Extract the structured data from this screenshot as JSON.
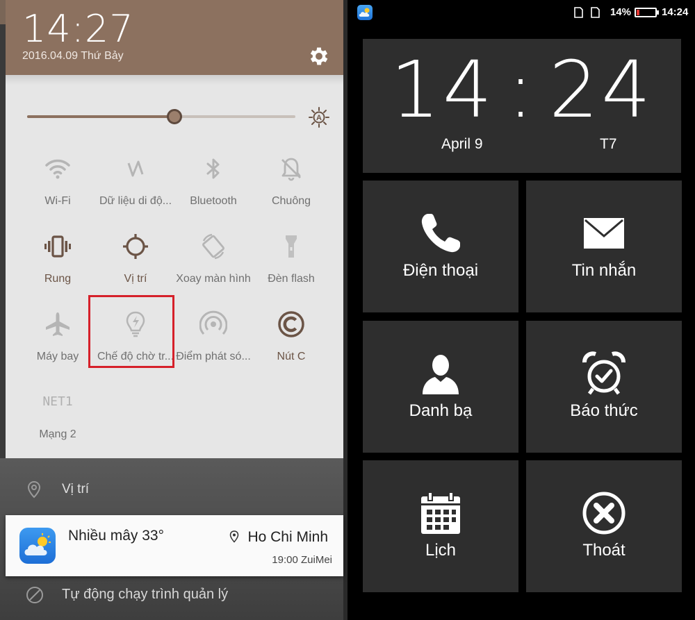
{
  "left_panel": {
    "clock": "14:27",
    "date": "2016.04.09 Thứ Bảy",
    "tiles": [
      {
        "label": "Wi-Fi",
        "icon": "wifi-icon",
        "active": false
      },
      {
        "label": "Dữ liệu di độ...",
        "icon": "mobile-data-icon",
        "active": false
      },
      {
        "label": "Bluetooth",
        "icon": "bluetooth-icon",
        "active": false
      },
      {
        "label": "Chuông",
        "icon": "bell-off-icon",
        "active": false
      },
      {
        "label": "Rung",
        "icon": "vibrate-icon",
        "active": true
      },
      {
        "label": "Vị trí",
        "icon": "location-target-icon",
        "active": true
      },
      {
        "label": "Xoay màn hình",
        "icon": "rotate-screen-icon",
        "active": false
      },
      {
        "label": "Đèn flash",
        "icon": "flashlight-icon",
        "active": false
      },
      {
        "label": "Máy bay",
        "icon": "airplane-icon",
        "active": false
      },
      {
        "label": "Chế độ chờ tr...",
        "icon": "power-saving-bulb-icon",
        "active": false
      },
      {
        "label": "Điểm phát só...",
        "icon": "hotspot-icon",
        "active": false
      },
      {
        "label": "Nút C",
        "icon": "c-button-icon",
        "active": true
      },
      {
        "label": "Mạng 2",
        "icon": "network-icon",
        "icon_text": "NET1",
        "active": false
      }
    ],
    "brightness_level": 0.55,
    "location_notification": "Vị trí",
    "weather": {
      "condition": "Nhiều mây 33°",
      "city": "Ho Chi Minh",
      "time": "19:00 ZuiMei"
    },
    "auto_start": "Tự động chạy trình quản lý"
  },
  "right_panel": {
    "status_bar": {
      "battery": "14%",
      "time": "14:24",
      "battery_level": 0.14
    },
    "clock": {
      "hours": "14",
      "minutes": "24",
      "date": "April 9",
      "day": "T7"
    },
    "apps": [
      {
        "label": "Điện thoại",
        "icon": "phone-icon"
      },
      {
        "label": "Tin nhắn",
        "icon": "envelope-icon"
      },
      {
        "label": "Danh bạ",
        "icon": "contact-person-icon"
      },
      {
        "label": "Báo thức",
        "icon": "alarm-clock-icon"
      },
      {
        "label": "Lịch",
        "icon": "calendar-icon"
      },
      {
        "label": "Thoát",
        "icon": "exit-x-icon"
      }
    ]
  },
  "colors": {
    "accent": "#8c715f",
    "highlight": "#d6202a",
    "tile_bg": "#2e2e2e"
  }
}
